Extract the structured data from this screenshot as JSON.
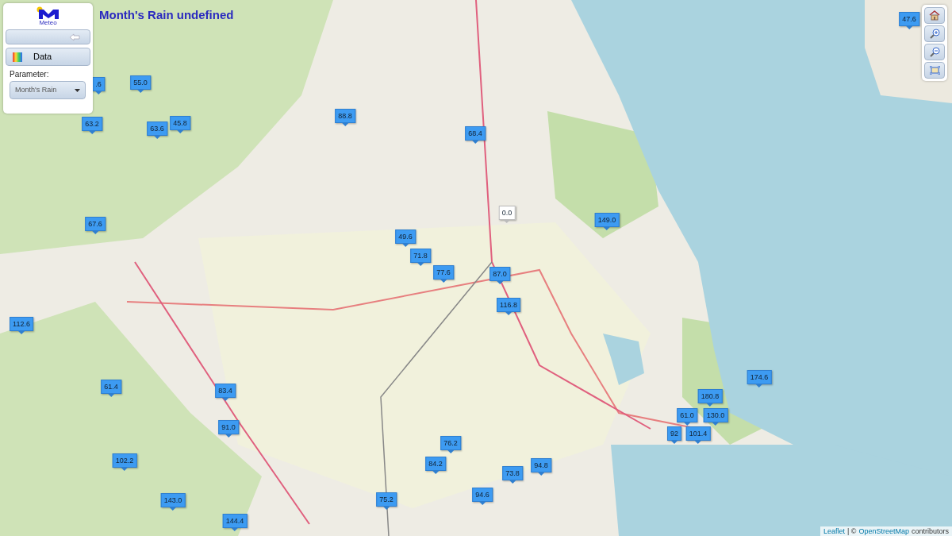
{
  "map_title": "Month's Rain undefined",
  "panel": {
    "logo_text": "Meteo",
    "data_button": "Data",
    "parameter_label": "Parameter:",
    "parameter_select": "Month's Rain"
  },
  "markers": [
    {
      "value": "55.0",
      "color": "#3d9bf2"
    },
    {
      "value": ".6",
      "color": "#3d9bf2"
    },
    {
      "value": "63.2",
      "color": "#3d9bf2"
    },
    {
      "value": "63.6",
      "color": "#3d9bf2"
    },
    {
      "value": "45.8",
      "color": "#3d9bf2"
    },
    {
      "value": "88.8",
      "color": "#3d9bf2"
    },
    {
      "value": "68.4",
      "color": "#3d9bf2"
    },
    {
      "value": "47.6",
      "color": "#3d9bf2"
    },
    {
      "value": "0.0",
      "color": "#ffffff"
    },
    {
      "value": "149.0",
      "color": "#3d9bf2"
    },
    {
      "value": "67.6",
      "color": "#3d9bf2"
    },
    {
      "value": "49.6",
      "color": "#3d9bf2"
    },
    {
      "value": "71.8",
      "color": "#3d9bf2"
    },
    {
      "value": "77.6",
      "color": "#3d9bf2"
    },
    {
      "value": "87.0",
      "color": "#3d9bf2"
    },
    {
      "value": "116.8",
      "color": "#3d9bf2"
    },
    {
      "value": "112.6",
      "color": "#3d9bf2"
    },
    {
      "value": "174.6",
      "color": "#3d9bf2"
    },
    {
      "value": "180.8",
      "color": "#3d9bf2"
    },
    {
      "value": "130.0",
      "color": "#3d9bf2"
    },
    {
      "value": "61.0",
      "color": "#3d9bf2"
    },
    {
      "value": "92",
      "color": "#3d9bf2"
    },
    {
      "value": "101.4",
      "color": "#3d9bf2"
    },
    {
      "value": "61.4",
      "color": "#3d9bf2"
    },
    {
      "value": "83.4",
      "color": "#3d9bf2"
    },
    {
      "value": "91.0",
      "color": "#3d9bf2"
    },
    {
      "value": "76.2",
      "color": "#3d9bf2"
    },
    {
      "value": "84.2",
      "color": "#3d9bf2"
    },
    {
      "value": "73.8",
      "color": "#3d9bf2"
    },
    {
      "value": "94.8",
      "color": "#3d9bf2"
    },
    {
      "value": "102.2",
      "color": "#3d9bf2"
    },
    {
      "value": "143.0",
      "color": "#3d9bf2"
    },
    {
      "value": "75.2",
      "color": "#3d9bf2"
    },
    {
      "value": "94.6",
      "color": "#3d9bf2"
    },
    {
      "value": "144.4",
      "color": "#3d9bf2"
    }
  ],
  "attribution": {
    "leaflet_link": "Leaflet",
    "separator": "| ©",
    "osm_link": "OpenStreetMap",
    "suffix": "contributors"
  }
}
